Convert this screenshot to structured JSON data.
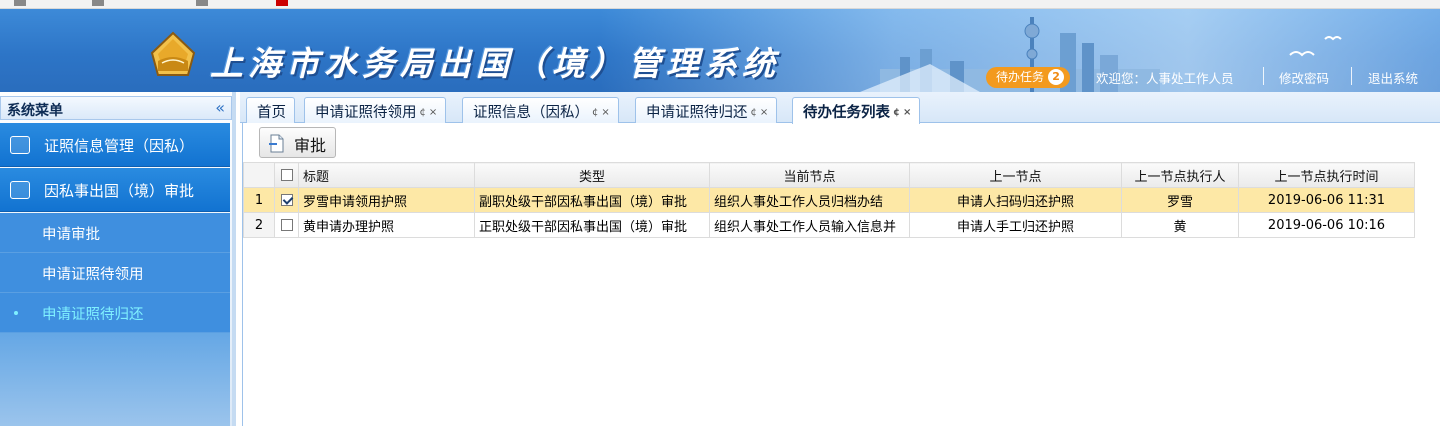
{
  "banner": {
    "title": "上海市水务局出国（境）管理系统",
    "todo_label": "待办任务",
    "todo_count": "2",
    "welcome": "欢迎您：人事处工作人员",
    "change_password": "修改密码",
    "logout": "退出系统"
  },
  "sidebar": {
    "title": "系统菜单",
    "collapse_icon": "double-chevron-left-icon",
    "groups": [
      {
        "label": "证照信息管理（因私）",
        "icon": "image-icon"
      },
      {
        "label": "因私事出国（境）审批",
        "icon": "edit-icon"
      }
    ],
    "items": [
      {
        "label": "申请审批"
      },
      {
        "label": "申请证照待领用"
      },
      {
        "label": "申请证照待归还",
        "active": true
      }
    ]
  },
  "tabs": [
    {
      "label": "首页"
    },
    {
      "label": "申请证照待领用"
    },
    {
      "label": "证照信息（因私）"
    },
    {
      "label": "申请证照待归还"
    },
    {
      "label": "待办任务列表",
      "active": true
    }
  ],
  "toolbar": {
    "approve_label": "审批"
  },
  "grid": {
    "columns": [
      "标题",
      "类型",
      "当前节点",
      "上一节点",
      "上一节点执行人",
      "上一节点执行时间"
    ],
    "rows": [
      {
        "num": "1",
        "checked": true,
        "title": "罗雪申请领用护照",
        "type": "副职处级干部因私事出国（境）审批",
        "current": "组织人事处工作人员归档办结",
        "prev": "申请人扫码归还护照",
        "prev_user": "罗雪",
        "prev_time": "2019-06-06 11:31"
      },
      {
        "num": "2",
        "checked": false,
        "title": "黄申请办理护照",
        "type": "正职处级干部因私事出国（境）审批",
        "current": "组织人事处工作人员输入信息并",
        "prev": "申请人手工归还护照",
        "prev_user": "黄",
        "prev_time": "2019-06-06 10:16"
      }
    ]
  },
  "colors": {
    "banner": "#2d75c7",
    "menu_group": "#1273d1",
    "selected_row": "#fde8a6",
    "todo_badge": "#f39a1e"
  }
}
